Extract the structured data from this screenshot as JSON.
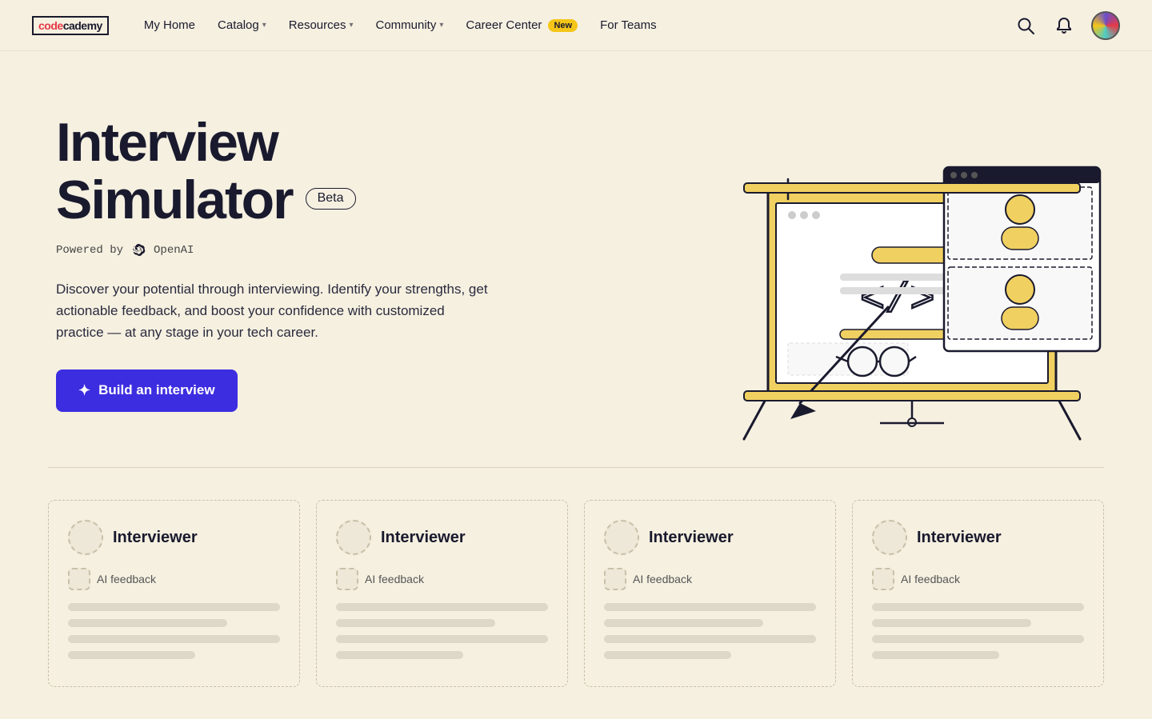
{
  "logo": {
    "code": "code",
    "academy": "cademy"
  },
  "nav": {
    "links": [
      {
        "label": "My Home",
        "hasChevron": false
      },
      {
        "label": "Catalog",
        "hasChevron": true
      },
      {
        "label": "Resources",
        "hasChevron": true
      },
      {
        "label": "Community",
        "hasChevron": true
      },
      {
        "label": "Career Center",
        "hasChevron": false,
        "badge": "New"
      },
      {
        "label": "For Teams",
        "hasChevron": false
      }
    ]
  },
  "hero": {
    "title_line1": "Interview",
    "title_line2": "Simulator",
    "beta_label": "Beta",
    "powered_by": "Powered by",
    "openai_label": "OpenAI",
    "description": "Discover your potential through interviewing. Identify your strengths, get actionable feedback, and boost your confidence with customized practice — at any stage in your tech career.",
    "cta_button": "Build an interview"
  },
  "cards": [
    {
      "title": "Interviewer",
      "tag": "AI feedback"
    },
    {
      "title": "Interviewer",
      "tag": "AI feedback"
    },
    {
      "title": "Interviewer",
      "tag": "AI feedback"
    },
    {
      "title": "Interviewer",
      "tag": "AI feedback"
    }
  ],
  "colors": {
    "bg": "#f5f0e0",
    "nav_border": "#e8e2ce",
    "cta_bg": "#3d2de0",
    "text_dark": "#1a1a2e",
    "badge_yellow": "#f5c518",
    "skeleton": "#ddd8c8",
    "card_border": "#c8c0a8"
  }
}
